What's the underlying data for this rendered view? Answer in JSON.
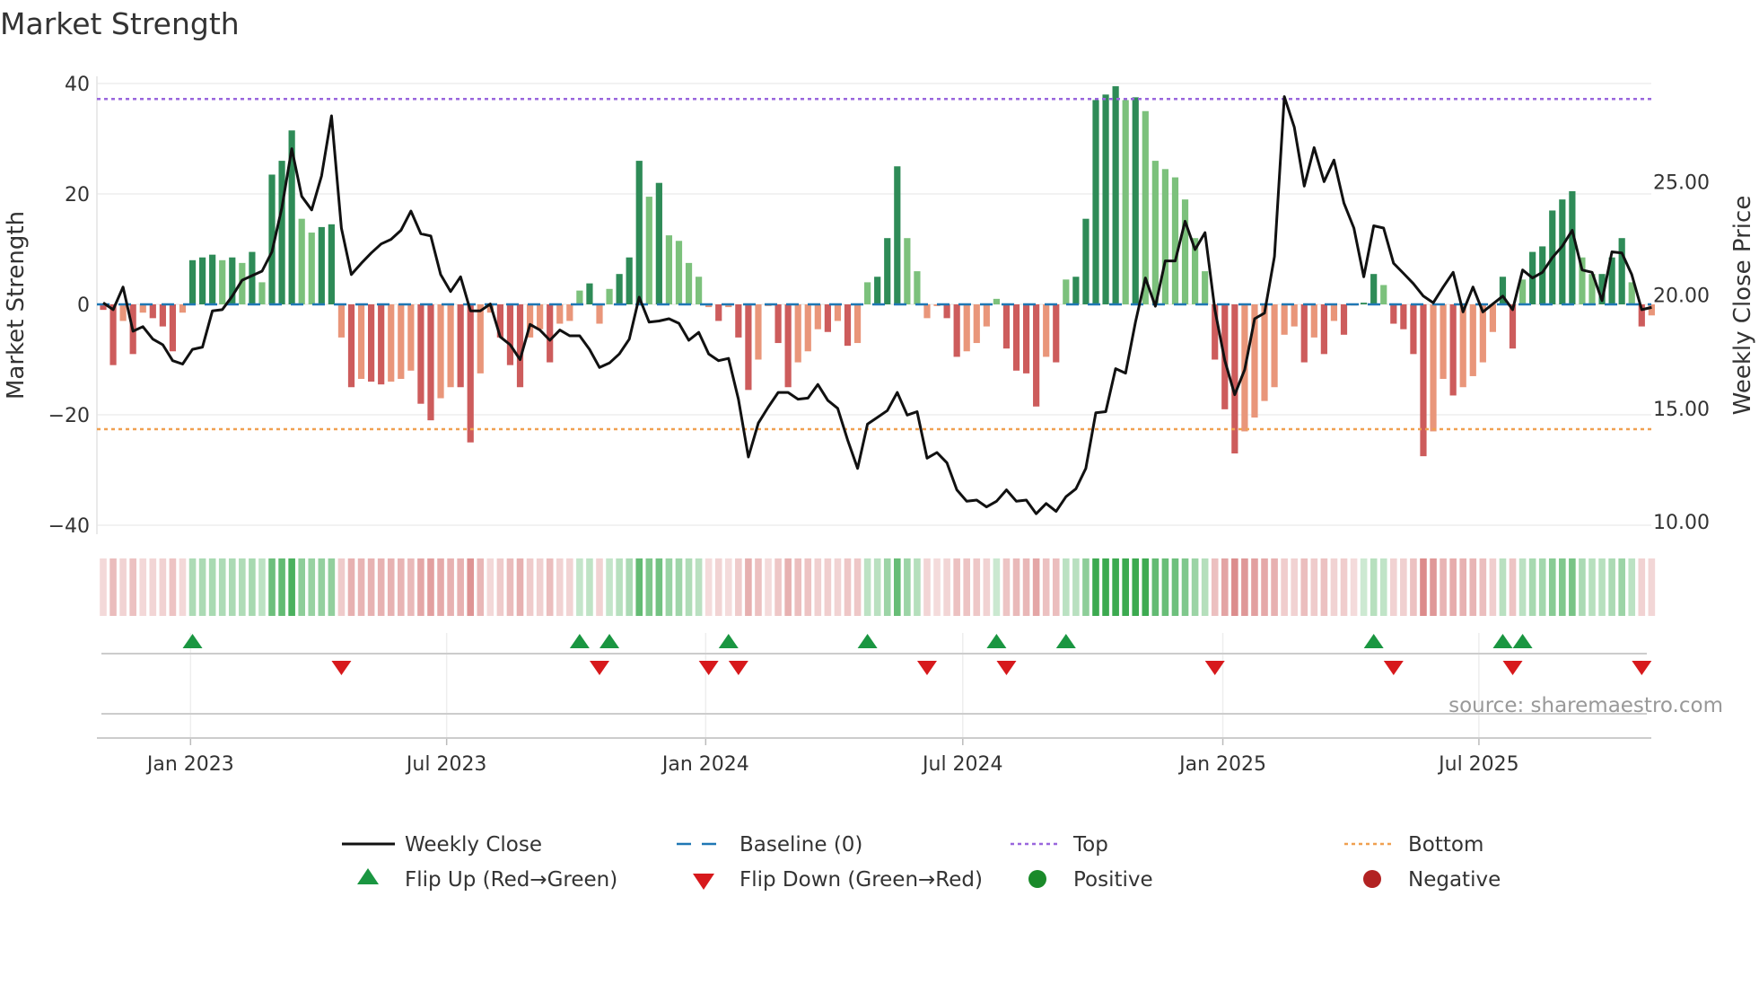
{
  "chart_data": {
    "type": "bar",
    "title": "Market Strength",
    "ylabel": "Market Strength",
    "y2label": "Weekly Close Price",
    "ylim": [
      -42,
      42
    ],
    "y2lim": [
      9.5,
      30.5
    ],
    "yticks": [
      "40",
      "20",
      "0",
      "−20",
      "−40"
    ],
    "ytick_values": [
      40,
      20,
      0,
      -20,
      -40
    ],
    "y2ticks": [
      "25.00",
      "20.00",
      "15.00",
      "10.00"
    ],
    "y2tick_values": [
      25,
      20,
      15,
      10
    ],
    "xticks": [
      "Jan 2023",
      "Jul 2023",
      "Jan 2024",
      "Jul 2024",
      "Jan 2025",
      "Jul 2025"
    ],
    "xtick_week_index": [
      8.8,
      34.6,
      60.7,
      86.6,
      112.8,
      138.6
    ],
    "top_level": 37.2,
    "bottom_level": -22.6,
    "baseline": 0,
    "strength": [
      -1,
      -11,
      -3,
      -9,
      -1.5,
      -2.5,
      -4,
      -8.5,
      -1.5,
      8,
      8.5,
      9,
      8,
      8.5,
      7.5,
      9.5,
      4,
      23.5,
      26,
      31.5,
      15.5,
      13,
      14,
      14.5,
      -6,
      -15,
      -13.5,
      -14,
      -14.5,
      -14,
      -13.5,
      -12,
      -18,
      -21,
      -17,
      -15,
      -15,
      -25,
      -12.5,
      -1.5,
      -6,
      -11,
      -15,
      -6,
      -4.5,
      -10.5,
      -3.5,
      -3,
      2.5,
      3.8,
      -3.5,
      2.8,
      5.5,
      8.5,
      26,
      19.5,
      22,
      12.5,
      11.5,
      7.5,
      5,
      -0.5,
      -3,
      -0.5,
      -6,
      -15.5,
      -10,
      -0.3,
      -7,
      -15,
      -10.5,
      -8.5,
      -4.5,
      -5,
      -3,
      -7.5,
      -7,
      4,
      5,
      12,
      25,
      12,
      6,
      -2.5,
      -0.3,
      -2.5,
      -9.5,
      -8.5,
      -7,
      -4,
      1,
      -8,
      -12,
      -12.5,
      -18.5,
      -9.5,
      -10.5,
      4.5,
      5,
      15.5,
      37,
      38,
      39.5,
      37,
      37.5,
      35,
      26,
      24.5,
      23,
      19,
      12,
      6,
      -10,
      -19,
      -27,
      -23,
      -20.5,
      -17.5,
      -15,
      -5.5,
      -4,
      -10.5,
      -6,
      -9,
      -3,
      -5.5,
      -0.2,
      0.3,
      5.5,
      3.5,
      -3.5,
      -4.5,
      -9,
      -27.5,
      -23,
      -13.5,
      -16.5,
      -15,
      -13,
      -10.5,
      -5,
      5,
      -8,
      4.5,
      9.5,
      10.5,
      17,
      19,
      20.5,
      8.5,
      5.5,
      5.5,
      8.5,
      12,
      4,
      -4,
      -2
    ],
    "weekly_close": [
      19.65,
      19.35,
      20.35,
      18.4,
      18.6,
      18.05,
      17.8,
      17.1,
      16.95,
      17.6,
      17.7,
      19.3,
      19.35,
      19.95,
      20.65,
      20.85,
      21.05,
      21.9,
      23.85,
      26.45,
      24.35,
      23.75,
      25.25,
      27.9,
      22.95,
      20.9,
      21.4,
      21.85,
      22.25,
      22.45,
      22.85,
      23.7,
      22.7,
      22.6,
      20.9,
      20.15,
      20.8,
      19.3,
      19.3,
      19.6,
      18.15,
      17.8,
      17.15,
      18.7,
      18.45,
      18.0,
      18.45,
      18.2,
      18.2,
      17.6,
      16.8,
      17.0,
      17.4,
      18.05,
      19.9,
      18.8,
      18.85,
      18.95,
      18.75,
      18.0,
      18.35,
      17.4,
      17.1,
      17.2,
      15.4,
      12.85,
      14.35,
      15.05,
      15.7,
      15.7,
      15.4,
      15.45,
      16.05,
      15.35,
      15.0,
      13.6,
      12.35,
      14.3,
      14.6,
      14.9,
      15.7,
      14.7,
      14.85,
      12.8,
      13.05,
      12.6,
      11.4,
      10.9,
      10.95,
      10.65,
      10.9,
      11.4,
      10.9,
      10.95,
      10.35,
      10.8,
      10.45,
      11.1,
      11.45,
      12.35,
      14.8,
      14.85,
      16.75,
      16.55,
      18.8,
      20.75,
      19.5,
      21.5,
      21.5,
      23.25,
      22.0,
      22.75,
      19.35,
      17.1,
      15.6,
      16.7,
      18.95,
      19.2,
      21.7,
      28.75,
      27.4,
      24.8,
      26.5,
      25.0,
      25.95,
      24.05,
      22.95,
      20.8,
      23.05,
      22.95,
      21.4,
      20.95,
      20.5,
      19.95,
      19.65,
      20.35,
      21.0,
      19.25,
      20.35,
      19.25,
      19.6,
      19.95,
      19.35,
      21.1,
      20.75,
      21.0,
      21.65,
      22.15,
      22.85,
      21.1,
      21.0,
      19.75,
      21.9,
      21.85,
      20.9,
      19.35,
      19.45
    ],
    "flip_up_week_index": [
      9,
      48,
      51,
      63,
      77,
      90,
      97,
      128,
      141,
      143
    ],
    "flip_down_week_index": [
      24,
      50,
      61,
      64,
      83,
      91,
      112,
      130,
      142,
      155
    ],
    "legend": {
      "weekly_close": "Weekly Close",
      "baseline": "Baseline (0)",
      "top": "Top",
      "bottom": "Bottom",
      "flip_up": "Flip Up (Red→Green)",
      "flip_down": "Flip Down (Green→Red)",
      "positive": "Positive",
      "negative": "Negative"
    },
    "legend_placement": "bottom",
    "source": "source: sharemaestro.com",
    "colors": {
      "pos_strong": "#2e8b57",
      "pos_weak": "#7cc17c",
      "neg_strong": "#cd5c5c",
      "neg_weak": "#e9967a",
      "line": "#111111",
      "baseline": "#1f77b4",
      "top": "#9966dd",
      "bottom": "#f0a050",
      "flip_up": "#1a9641",
      "flip_down": "#d7191c",
      "positive": "#1a8a2a",
      "negative": "#b22222"
    }
  }
}
